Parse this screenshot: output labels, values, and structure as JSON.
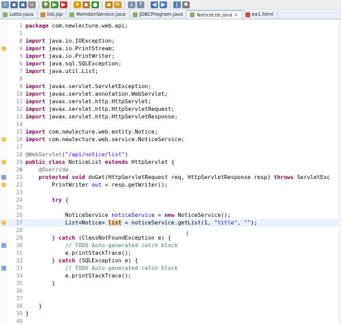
{
  "toolbar": {
    "buttons": [
      {
        "name": "new-icon",
        "color": "#6e8fbf",
        "glyph": "▫"
      },
      {
        "name": "save-icon",
        "color": "#4f6fa3",
        "glyph": "▪"
      },
      {
        "name": "save-all-icon",
        "color": "#4f6fa3",
        "glyph": "▪"
      },
      {
        "name": "print-icon",
        "color": "#8c8c8c",
        "glyph": "▫"
      },
      {
        "name": "sep"
      },
      {
        "name": "debug-icon",
        "color": "#6b8e3e",
        "glyph": "✱"
      },
      {
        "name": "run-icon",
        "color": "#3c9a3c",
        "glyph": "▶"
      },
      {
        "name": "external-tools-icon",
        "color": "#c0392b",
        "glyph": "▶"
      },
      {
        "name": "sep"
      },
      {
        "name": "new-java-project-icon",
        "color": "#d4a017",
        "glyph": "✦"
      },
      {
        "name": "new-package-icon",
        "color": "#b08030",
        "glyph": "▪"
      },
      {
        "name": "new-class-icon",
        "color": "#3c8c3c",
        "glyph": "●"
      },
      {
        "name": "sep"
      },
      {
        "name": "open-type-icon",
        "color": "#c08a2a",
        "glyph": "▪"
      },
      {
        "name": "search-icon",
        "color": "#d0a030",
        "glyph": "✎"
      },
      {
        "name": "sep"
      },
      {
        "name": "next-annotation-icon",
        "color": "#7a8fae",
        "glyph": "↓"
      },
      {
        "name": "previous-annotation-icon",
        "color": "#7a8fae",
        "glyph": "↑"
      },
      {
        "name": "sep"
      },
      {
        "name": "back-icon",
        "color": "#4b79b8",
        "glyph": "◀"
      },
      {
        "name": "forward-icon",
        "color": "#4b79b8",
        "glyph": "▶"
      },
      {
        "name": "sep"
      },
      {
        "name": "perspective-java-icon",
        "color": "#5a7fb4",
        "glyph": "J"
      },
      {
        "name": "perspective-debug-icon",
        "color": "#7a7a7a",
        "glyph": "✱"
      }
    ]
  },
  "tabs": [
    {
      "label": "Lotto.java",
      "icon_color": "#8ab06b",
      "active": false
    },
    {
      "label": "list.jsp",
      "icon_color": "#d08a3c",
      "active": false
    },
    {
      "label": "MemberService.java",
      "icon_color": "#8ab06b",
      "active": false
    },
    {
      "label": "JDBCProgram.java",
      "icon_color": "#8ab06b",
      "active": false
    },
    {
      "label": "NoticeList.java",
      "icon_color": "#8ab06b",
      "active": true
    },
    {
      "label": "ex1.html",
      "icon_color": "#d04a3c",
      "active": false
    }
  ],
  "editor": {
    "current_line": 27,
    "lines": [
      {
        "n": "1",
        "tokens": [
          [
            "kw",
            "package"
          ],
          [
            "t",
            " com.newlecture.web.api;"
          ]
        ]
      },
      {
        "n": "2",
        "tokens": []
      },
      {
        "n": "3",
        "fold": "⊖",
        "tokens": [
          [
            "kw",
            "import"
          ],
          [
            "t",
            " java.io.IOException;"
          ]
        ]
      },
      {
        "n": "4",
        "marker": "warn",
        "tokens": [
          [
            "kw",
            "import"
          ],
          [
            "t",
            " java.io.PrintStream;"
          ]
        ]
      },
      {
        "n": "5",
        "tokens": [
          [
            "kw",
            "import"
          ],
          [
            "t",
            " java.io.PrintWriter;"
          ]
        ]
      },
      {
        "n": "6",
        "tokens": [
          [
            "kw",
            "import"
          ],
          [
            "t",
            " java.sql.SQLException;"
          ]
        ]
      },
      {
        "n": "7",
        "tokens": [
          [
            "kw",
            "import"
          ],
          [
            "t",
            " java.util.List;"
          ]
        ]
      },
      {
        "n": "8",
        "tokens": []
      },
      {
        "n": "9",
        "tokens": [
          [
            "kw",
            "import"
          ],
          [
            "t",
            " javax.servlet.ServletException;"
          ]
        ]
      },
      {
        "n": "10",
        "tokens": [
          [
            "kw",
            "import"
          ],
          [
            "t",
            " javax.servlet.annotation.WebServlet;"
          ]
        ]
      },
      {
        "n": "11",
        "tokens": [
          [
            "kw",
            "import"
          ],
          [
            "t",
            " javax.servlet.http.HttpServlet;"
          ]
        ]
      },
      {
        "n": "12",
        "tokens": [
          [
            "kw",
            "import"
          ],
          [
            "t",
            " javax.servlet.http.HttpServletRequest;"
          ]
        ]
      },
      {
        "n": "13",
        "tokens": [
          [
            "kw",
            "import"
          ],
          [
            "t",
            " javax.servlet.http.HttpServletResponse;"
          ]
        ]
      },
      {
        "n": "14",
        "tokens": []
      },
      {
        "n": "15",
        "tokens": [
          [
            "kw",
            "import"
          ],
          [
            "t",
            " com.newlecture.web.entity.Notice;"
          ]
        ]
      },
      {
        "n": "16",
        "marker": "warn",
        "tokens": [
          [
            "kw",
            "import"
          ],
          [
            "t",
            " com.newlecture.web.service.NoticeService;"
          ]
        ]
      },
      {
        "n": "17",
        "tokens": []
      },
      {
        "n": "18",
        "tokens": [
          [
            "ann",
            "@WebServlet"
          ],
          [
            "t",
            "("
          ],
          [
            "str",
            "\"/api/notice/list\""
          ],
          [
            "t",
            ")"
          ]
        ]
      },
      {
        "n": "19",
        "marker": "warn",
        "tokens": [
          [
            "kw",
            "public"
          ],
          [
            "t",
            " "
          ],
          [
            "kw",
            "class"
          ],
          [
            "t",
            " NoticeList "
          ],
          [
            "kw",
            "extends"
          ],
          [
            "t",
            " HttpServlet {"
          ]
        ]
      },
      {
        "n": "20",
        "fold": "⊖",
        "tokens": [
          [
            "t",
            "    "
          ],
          [
            "ann",
            "@Override"
          ]
        ]
      },
      {
        "n": "21",
        "marker": "info",
        "tokens": [
          [
            "t",
            "    "
          ],
          [
            "kw",
            "protected"
          ],
          [
            "t",
            " "
          ],
          [
            "kw",
            "void"
          ],
          [
            "t",
            " doGet(HttpServletRequest req, HttpServletResponse resp) "
          ],
          [
            "kw",
            "throws"
          ],
          [
            "t",
            " ServletExc"
          ]
        ]
      },
      {
        "n": "22",
        "marker": "warn",
        "tokens": [
          [
            "t",
            "        PrintWriter "
          ],
          [
            "fld",
            "out"
          ],
          [
            "t",
            " = resp.getWriter();"
          ]
        ]
      },
      {
        "n": "23",
        "tokens": []
      },
      {
        "n": "24",
        "tokens": [
          [
            "t",
            "        "
          ],
          [
            "kw",
            "try"
          ],
          [
            "t",
            " {"
          ]
        ]
      },
      {
        "n": "25",
        "tokens": []
      },
      {
        "n": "26",
        "tokens": [
          [
            "t",
            "            NoticeService "
          ],
          [
            "fld",
            "noticeService"
          ],
          [
            "t",
            " = "
          ],
          [
            "kw",
            "new"
          ],
          [
            "t",
            " NoticeService();"
          ]
        ]
      },
      {
        "n": "27",
        "marker": "warn",
        "tokens": [
          [
            "t",
            "            List<Notice> "
          ],
          [
            "hl",
            "list"
          ],
          [
            "t",
            " = noticeService.getList(1, "
          ],
          [
            "str",
            "\"title\""
          ],
          [
            "t",
            ", "
          ],
          [
            "str",
            "\"\""
          ],
          [
            "t",
            ");"
          ]
        ]
      },
      {
        "n": "28",
        "tokens": []
      },
      {
        "n": "29",
        "tokens": [
          [
            "t",
            "        } "
          ],
          [
            "kw",
            "catch"
          ],
          [
            "t",
            " (ClassNotFoundException e) {"
          ]
        ]
      },
      {
        "n": "30",
        "marker": "info",
        "tokens": [
          [
            "t",
            "            "
          ],
          [
            "com",
            "// TODO Auto-generated catch block"
          ]
        ]
      },
      {
        "n": "31",
        "tokens": [
          [
            "t",
            "            e.printStackTrace();"
          ]
        ]
      },
      {
        "n": "32",
        "tokens": [
          [
            "t",
            "        } "
          ],
          [
            "kw",
            "catch"
          ],
          [
            "t",
            " (SQLException e) {"
          ]
        ]
      },
      {
        "n": "33",
        "marker": "info",
        "tokens": [
          [
            "t",
            "            "
          ],
          [
            "com",
            "// TODO Auto-generated catch block"
          ]
        ]
      },
      {
        "n": "34",
        "tokens": [
          [
            "t",
            "            e.printStackTrace();"
          ]
        ]
      },
      {
        "n": "35",
        "tokens": [
          [
            "t",
            "        }"
          ]
        ]
      },
      {
        "n": "36",
        "tokens": []
      },
      {
        "n": "37",
        "tokens": []
      },
      {
        "n": "38",
        "tokens": [
          [
            "t",
            "    }"
          ]
        ]
      },
      {
        "n": "39",
        "tokens": [
          [
            "t",
            "}"
          ]
        ]
      },
      {
        "n": "40",
        "tokens": []
      }
    ]
  },
  "cursor_glyph": "I"
}
